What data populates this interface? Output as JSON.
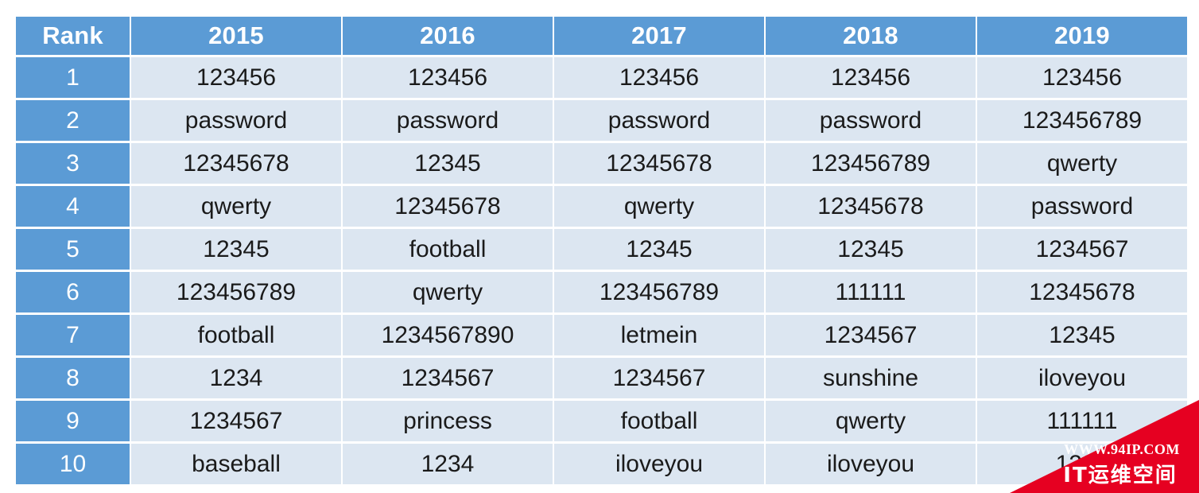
{
  "table": {
    "columns": [
      "Rank",
      "2015",
      "2016",
      "2017",
      "2018",
      "2019"
    ],
    "rows": [
      {
        "rank": "1",
        "y2015": "123456",
        "y2016": "123456",
        "y2017": "123456",
        "y2018": "123456",
        "y2019": "123456"
      },
      {
        "rank": "2",
        "y2015": "password",
        "y2016": "password",
        "y2017": "password",
        "y2018": "password",
        "y2019": "123456789"
      },
      {
        "rank": "3",
        "y2015": "12345678",
        "y2016": "12345",
        "y2017": "12345678",
        "y2018": "123456789",
        "y2019": "qwerty"
      },
      {
        "rank": "4",
        "y2015": "qwerty",
        "y2016": "12345678",
        "y2017": "qwerty",
        "y2018": "12345678",
        "y2019": "password"
      },
      {
        "rank": "5",
        "y2015": "12345",
        "y2016": "football",
        "y2017": "12345",
        "y2018": "12345",
        "y2019": "1234567"
      },
      {
        "rank": "6",
        "y2015": "123456789",
        "y2016": "qwerty",
        "y2017": "123456789",
        "y2018": "111111",
        "y2019": "12345678"
      },
      {
        "rank": "7",
        "y2015": "football",
        "y2016": "1234567890",
        "y2017": "letmein",
        "y2018": "1234567",
        "y2019": "12345"
      },
      {
        "rank": "8",
        "y2015": "1234",
        "y2016": "1234567",
        "y2017": "1234567",
        "y2018": "sunshine",
        "y2019": "iloveyou"
      },
      {
        "rank": "9",
        "y2015": "1234567",
        "y2016": "princess",
        "y2017": "football",
        "y2018": "qwerty",
        "y2019": "111111"
      },
      {
        "rank": "10",
        "y2015": "baseball",
        "y2016": "1234",
        "y2017": "iloveyou",
        "y2018": "iloveyou",
        "y2019": "1234"
      }
    ]
  },
  "watermark": {
    "url": "WWW.94IP.COM",
    "brand": "IT运维空间",
    "color": "#E60021"
  },
  "colors": {
    "header_blue": "#5B9BD5",
    "cell_fill": "#DCE6F1",
    "page_bg": "#FFFFFF",
    "header_text": "#FFFFFF",
    "cell_text": "#1A1A1A"
  }
}
